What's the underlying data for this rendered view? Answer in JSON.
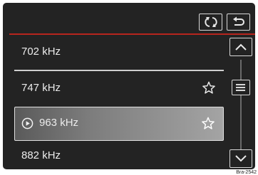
{
  "icons": {
    "refresh": "refresh-icon",
    "back": "back-icon",
    "favorite": "star-outline-icon",
    "play": "play-circle-icon",
    "scroll_up": "chevron-up-icon",
    "scroll_down": "chevron-down-icon",
    "thumb": "scroll-thumb-lines"
  },
  "colors": {
    "screen_bg": "#232323",
    "accent_red": "#b8251e",
    "text": "#ececec"
  },
  "stations": [
    {
      "label": "702 kHz",
      "favorite": false,
      "playing": false
    },
    {
      "label": "747 kHz",
      "favorite": true,
      "playing": false
    },
    {
      "label": "963 kHz",
      "favorite": true,
      "playing": true
    },
    {
      "label": "882 kHz",
      "favorite": false,
      "playing": false
    }
  ],
  "footer": {
    "code": "Bra-2542"
  }
}
